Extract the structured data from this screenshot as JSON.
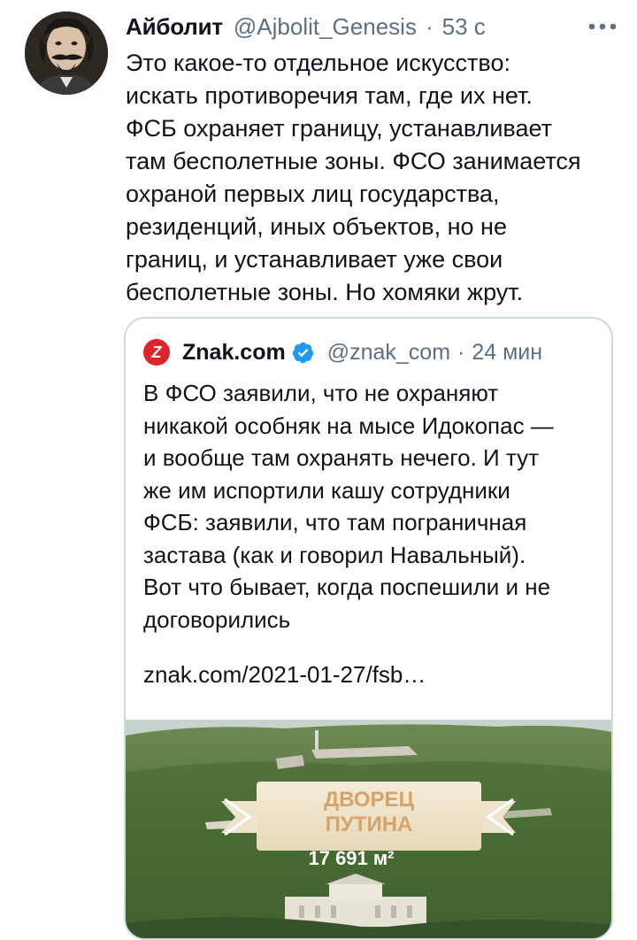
{
  "tweet": {
    "author_name": "Айболит",
    "author_handle": "@Ajbolit_Genesis",
    "separator": "·",
    "time": "53 с",
    "text": "Это какое-то отдельное искусство:\nискать противоречия там, где их нет.\nФСБ охраняет границу, устанавливает\nтам бесполетные зоны. ФСО занимается\nохраной первых лиц государства,\nрезиденций, иных объектов, но не\nграниц, и устанавливает уже свои\nбесполетные зоны. Но хомяки жрут.",
    "icons": {
      "avatar": "profile-photo",
      "more": "more-dots-icon"
    }
  },
  "quote": {
    "logo_letter": "Z",
    "author_name": "Znak.com",
    "author_handle": "@znak_com",
    "separator": "·",
    "time": "24 мин",
    "text": "В ФСО заявили, что не охраняют\nникакой особняк на мысе Идокопас —\nи вообще там охранять нечего. И тут\nже им испортили кашу сотрудники\nФСБ: заявили, что там пограничная\nзастава (как и говорил Навальный).\nВот что бывает, когда поспешили и не\nдоговорились",
    "link": "znak.com/2021-01-27/fsb…",
    "media": {
      "banner_line1": "ДВОРЕЦ",
      "banner_line2": "ПУТИНА",
      "area": "17 691 м²"
    },
    "icons": {
      "logo": "znak-logo-icon",
      "verified": "verified-badge-icon"
    }
  },
  "colors": {
    "text": "#0f1419",
    "secondary": "#5b7083",
    "verified": "#1d9bf0",
    "card_border": "#cfd9de",
    "znak_red": "#e0242b"
  }
}
